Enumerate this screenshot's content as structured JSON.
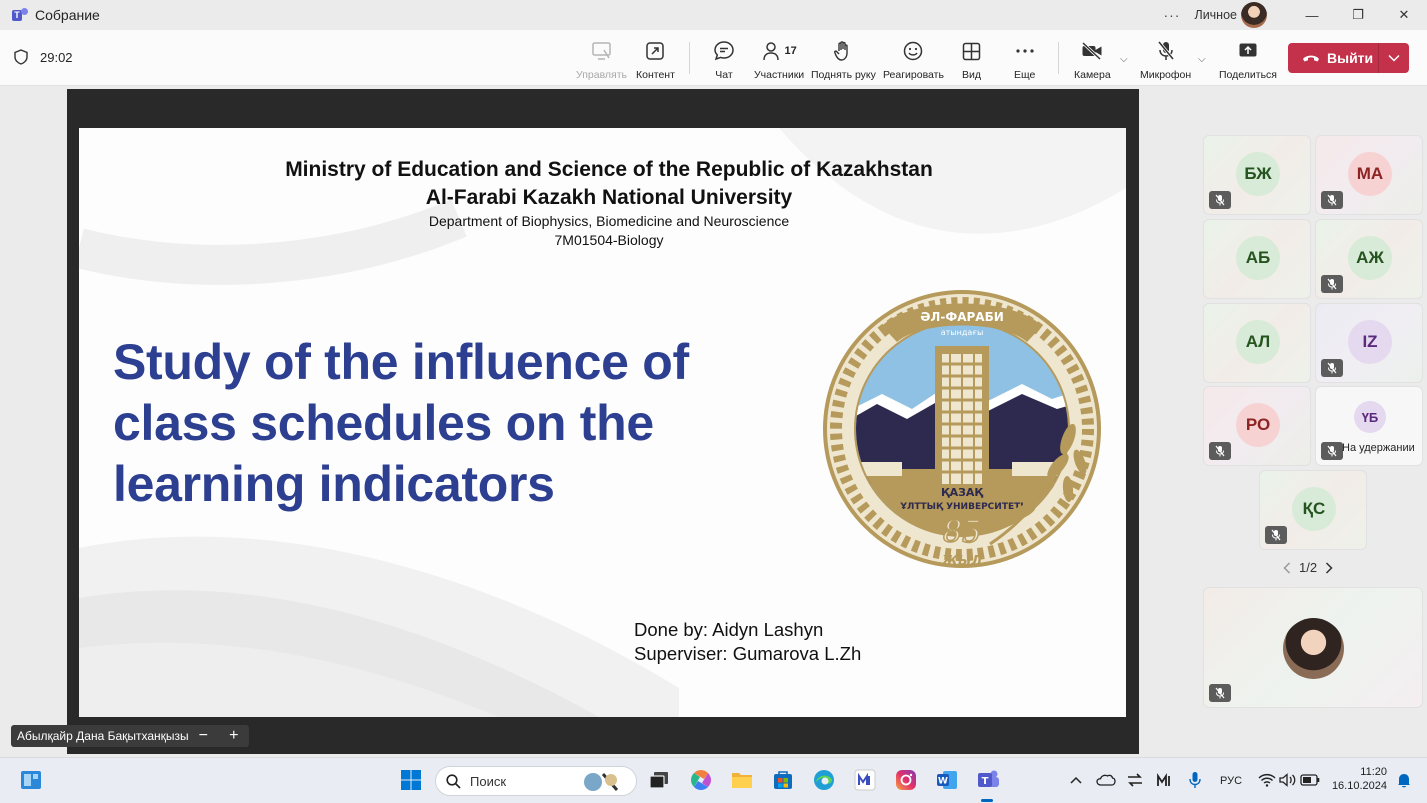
{
  "window": {
    "title": "Собрание",
    "account_label": "Личное",
    "minimize_glyph": "—",
    "maximize_glyph": "❐",
    "close_glyph": "✕",
    "more_glyph": "···"
  },
  "toolbar": {
    "timer": "29:02",
    "manage_label": "Управлять",
    "content_label": "Контент",
    "chat_label": "Чат",
    "participants_label": "Участники",
    "participants_count": "17",
    "raise_hand_label": "Поднять руку",
    "react_label": "Реагировать",
    "view_label": "Вид",
    "more_label": "Еще",
    "camera_label": "Камера",
    "mic_label": "Микрофон",
    "share_label": "Поделиться",
    "leave_label": "Выйти"
  },
  "slide": {
    "ministry": "Ministry of Education and Science of the Republic of Kazakhstan",
    "university": "Al-Farabi Kazakh National University",
    "department": "Department of Biophysics, Biomedicine and Neuroscience",
    "program": "7M01504-Biology",
    "title_line1": "Study of the influence of",
    "title_line2": "class schedules on the",
    "title_line3": "learning indicators",
    "done_by": "Done by: Aidyn Lashyn",
    "supervisor": "Superviser: Gumarova L.Zh",
    "emblem_top": "ӘЛ-ФАРАБИ",
    "emblem_top2": "атындағы",
    "emblem_bottom1": "ҚАЗАҚ",
    "emblem_bottom2": "ҰЛТТЫҚ УНИВЕРСИТЕТІ",
    "emblem_number": "85",
    "emblem_year": "ЖЫЛ"
  },
  "presenter": {
    "name": "Абылқайр Дана Бақытханқызы",
    "zoom_out": "−",
    "zoom_in": "+"
  },
  "participants": [
    {
      "initials": "БЖ"
    },
    {
      "initials": "МА"
    },
    {
      "initials": "АБ"
    },
    {
      "initials": "АЖ"
    },
    {
      "initials": "АЛ"
    },
    {
      "initials": "IZ"
    },
    {
      "initials": "РО"
    },
    {
      "initials": "ҮБ",
      "status": "На удержании"
    },
    {
      "initials": "ҚС"
    }
  ],
  "pager": {
    "text": "1/2"
  },
  "taskbar": {
    "search_placeholder": "Поиск",
    "lang": "РУС",
    "time": "11:20",
    "date": "16.10.2024"
  },
  "colors": {
    "leave": "#c4314b",
    "slide_title": "#2c3f91",
    "emblem_gold": "#b59a5b",
    "emblem_navy": "#2e2a4f",
    "emblem_sky": "#8ec1e3",
    "taskbar_accent": "#0067c0"
  },
  "icons": {
    "shield": "shield-icon",
    "manage": "manage-icon",
    "content": "share-screen-icon",
    "chat": "chat-icon",
    "participants": "people-icon",
    "raise_hand": "hand-icon",
    "react": "smiley-icon",
    "view": "grid-icon",
    "more": "more-icon",
    "camera": "camera-off-icon",
    "mic": "mic-off-icon",
    "share": "share-up-icon",
    "leave": "phone-hangup-icon"
  }
}
